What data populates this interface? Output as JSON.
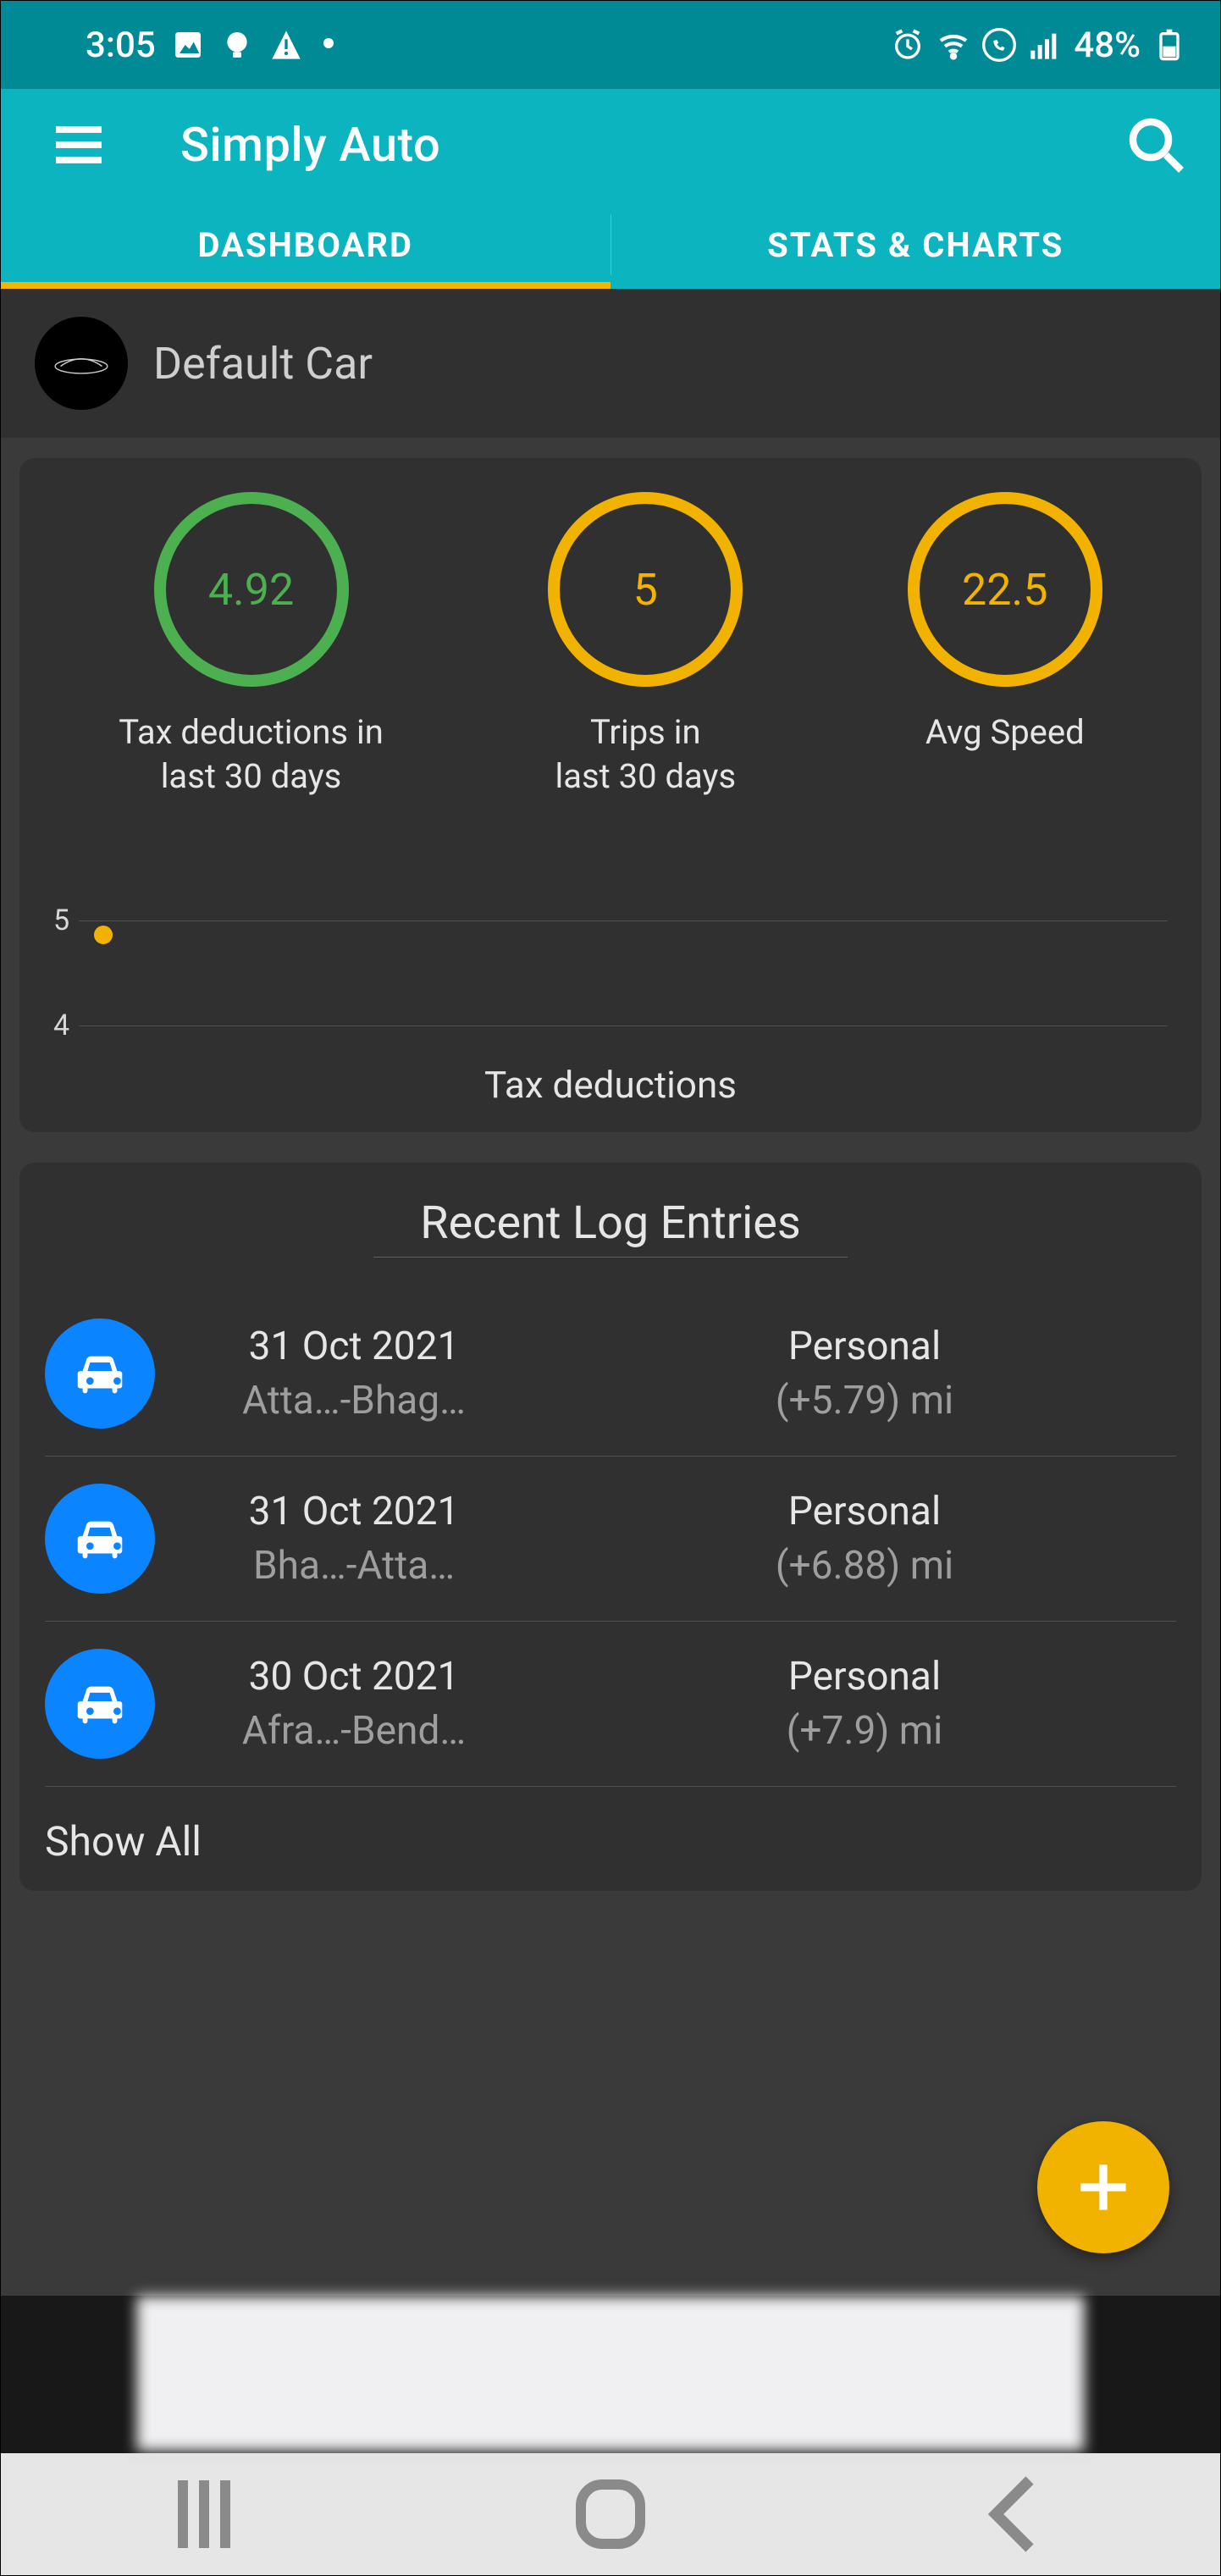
{
  "status_bar": {
    "time": "3:05",
    "battery_percent": "48%"
  },
  "app": {
    "title": "Simply Auto",
    "tabs": {
      "dashboard": "DASHBOARD",
      "stats": "STATS & CHARTS"
    }
  },
  "vehicle": {
    "name": "Default Car"
  },
  "stats": [
    {
      "value": "4.92",
      "label": "Tax deductions in\nlast 30 days"
    },
    {
      "value": "5",
      "label": "Trips in\nlast 30 days"
    },
    {
      "value": "22.5",
      "label": "Avg Speed"
    }
  ],
  "chart_data": {
    "type": "line",
    "title": "Tax deductions",
    "ylabel": "",
    "xlabel": "",
    "ylim": [
      4,
      5
    ],
    "y_ticks": [
      "5",
      "4"
    ],
    "series": [
      {
        "name": "Tax deductions",
        "x": [
          1
        ],
        "values": [
          4.92
        ]
      }
    ]
  },
  "chart": {
    "y5": "5",
    "y4": "4",
    "caption": "Tax deductions"
  },
  "log": {
    "title": "Recent Log Entries",
    "show_all": "Show All",
    "entries": [
      {
        "date": "31 Oct 2021",
        "route": "Atta…-Bhag…",
        "type": "Personal",
        "distance": "(+5.79) mi"
      },
      {
        "date": "31 Oct 2021",
        "route": "Bha…-Atta…",
        "type": "Personal",
        "distance": "(+6.88) mi"
      },
      {
        "date": "30 Oct 2021",
        "route": "Afra…-Bend…",
        "type": "Personal",
        "distance": "(+7.9) mi"
      }
    ]
  }
}
